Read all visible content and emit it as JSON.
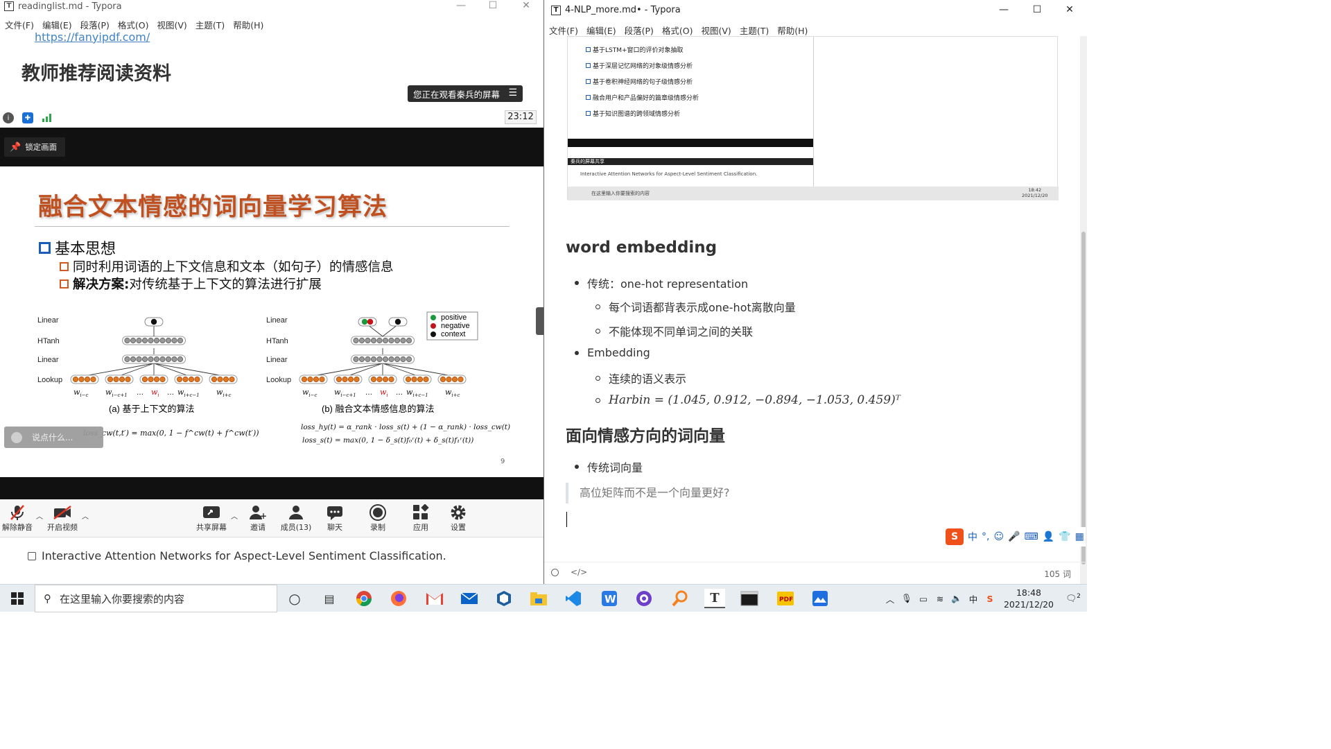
{
  "left_window": {
    "title": "readinglist.md - Typora",
    "menu": [
      "文件(F)",
      "编辑(E)",
      "段落(P)",
      "格式(O)",
      "视图(V)",
      "主题(T)",
      "帮助(H)"
    ],
    "link": "https://fanyipdf.com/",
    "heading": "教师推荐阅读资料",
    "share_banner": "您正在观看秦兵的屏幕",
    "timer": "23:12",
    "lock_button": "锁定画面",
    "slide": {
      "title": "融合文本情感的词向量学习算法",
      "bullet1": "基本思想",
      "bullet2": "同时利用词语的上下文信息和文本（如句子）的情感信息",
      "bullet3_bold": "解决方案:",
      "bullet3_rest": " 对传统基于上下文的算法进行扩展",
      "page": "9",
      "fig_a": {
        "layers": [
          "Linear",
          "HTanh",
          "Linear",
          "Lookup"
        ],
        "words": [
          "w",
          "w",
          "w",
          "w",
          "w"
        ],
        "word_subs": [
          "i−c",
          "i−c+1",
          "i",
          "i+c−1",
          "i+c"
        ],
        "dots": [
          "…",
          "…"
        ],
        "caption": "(a) 基于上下文的算法",
        "loss": "loss_cw(t,t′) = max(0, 1 − f^cw(t) + f^cw(t′))"
      },
      "fig_b": {
        "layers": [
          "Linear",
          "HTanh",
          "Linear",
          "Lookup"
        ],
        "caption": "(b) 融合文本情感信息的算法",
        "legend": [
          "positive",
          "negative",
          "context"
        ],
        "loss1": "loss_hy(t) = α_rank · loss_s(t) + (1 − α_rank) · loss_cw(t)",
        "loss2": "loss_s(t) = max(0, 1 − δ_s(t)f₀ʳ(t) + δ_s(t)f₁ʳ(t))"
      }
    },
    "chat_placeholder": "说点什么...",
    "toolbar": {
      "mute": "解除静音",
      "video": "开启视频",
      "share": "共享屏幕",
      "invite": "邀请",
      "members": "成员(13)",
      "chat": "聊天",
      "record": "录制",
      "apps": "应用",
      "settings": "设置"
    },
    "bottom_task": "Interactive Attention Networks for Aspect-Level Sentiment Classification."
  },
  "right_window": {
    "title": "4-NLP_more.md• - Typora",
    "menu": [
      "文件(F)",
      "编辑(E)",
      "段落(P)",
      "格式(O)",
      "视图(V)",
      "主题(T)",
      "帮助(H)"
    ],
    "thumb_items": [
      "基于LSTM+窗口的评价对象抽取",
      "基于深层记忆网络的对象级情感分析",
      "基于卷积神经网络的句子级情感分析",
      "融合用户和产品偏好的篇章级情感分析",
      "基于知识图谱的跨领域情感分析"
    ],
    "thumb_share_label": "秦兵的屏幕共享",
    "thumb_task": "Interactive Attention Networks for Aspect-Level Sentiment Classification.",
    "thumb_search": "在这里输入你要搜索的内容",
    "thumb_time": "18:42",
    "thumb_date": "2021/12/20",
    "h2a": "word embedding",
    "list1": {
      "item": "传统：one-hot representation",
      "sub": [
        "每个词语都背表示成one-hot离散向量",
        "不能体现不同单词之间的关联"
      ]
    },
    "list2": {
      "item": "Embedding",
      "sub": [
        "连续的语义表示",
        "Harbin = (1.045, 0.912, −0.894, −1.053, 0.459)ᵀ"
      ]
    },
    "h2b": "面向情感方向的词向量",
    "list3": {
      "item": "传统词向量"
    },
    "quote": "高位矩阵而不是一个向量更好?",
    "word_count": "105 词",
    "ime": "中"
  },
  "taskbar": {
    "search_placeholder": "在这里输入你要搜索的内容",
    "time": "18:48",
    "date": "2021/12/20",
    "ime": "中",
    "notif": "2"
  },
  "colors": {
    "slide_title": "#c0501f",
    "bullet_blue": "#1a5db8",
    "bullet_orange": "#d35a1f",
    "link": "#4183c4",
    "positive": "#1a9a3a",
    "negative": "#c8121a",
    "context": "#111111"
  }
}
